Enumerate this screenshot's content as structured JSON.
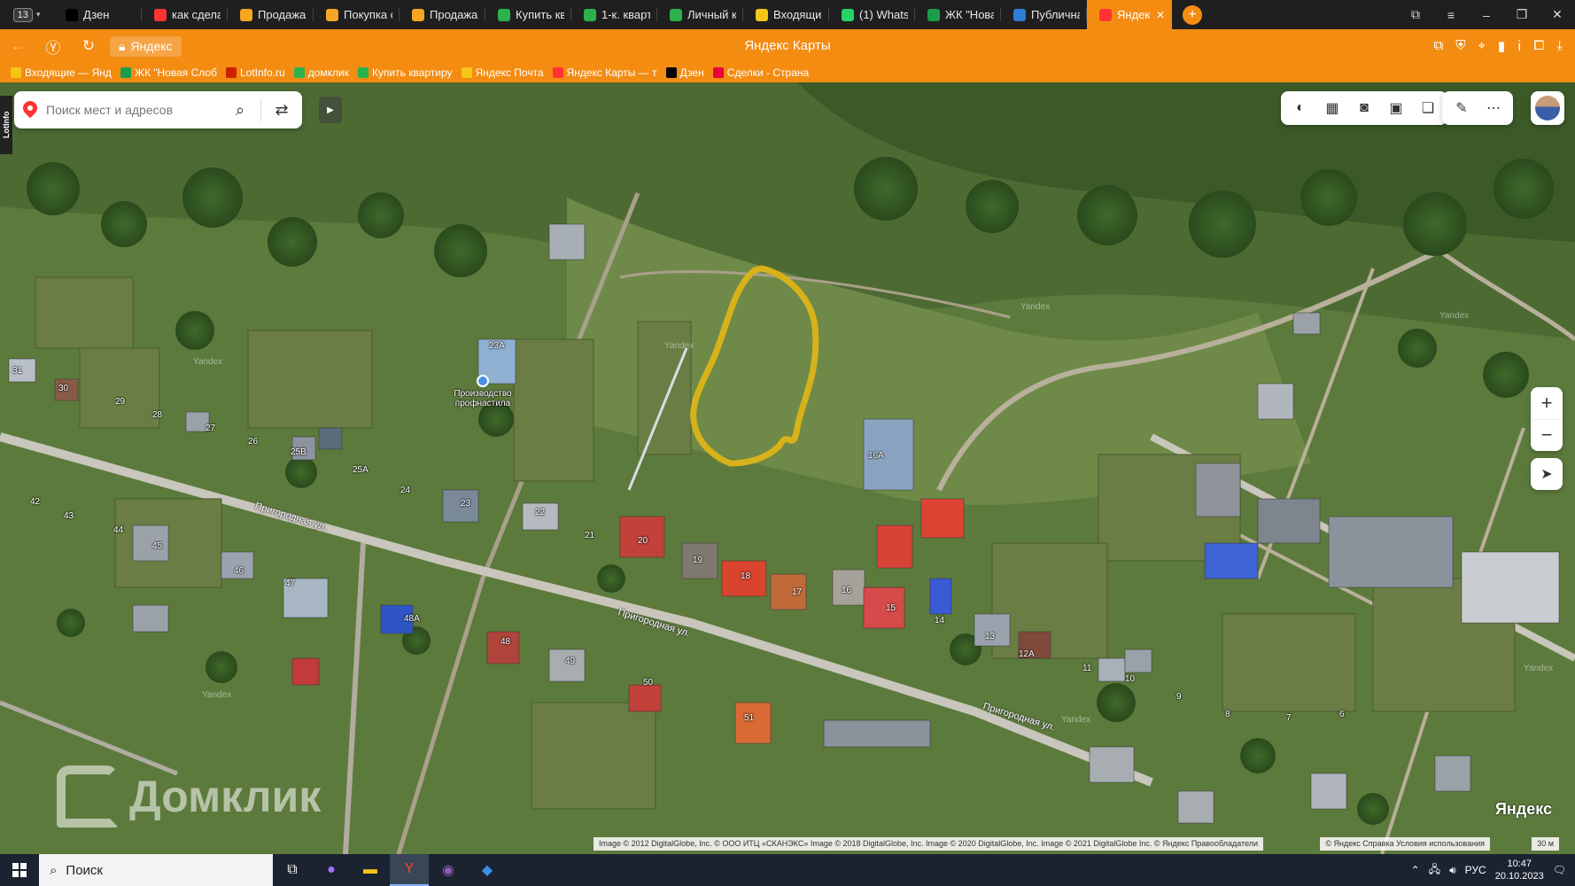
{
  "browser": {
    "tab_count": "13",
    "tabs": [
      {
        "label": "Дзен",
        "color": "#000000"
      },
      {
        "label": "как сделать",
        "color": "#ff3333"
      },
      {
        "label": "Продажа об",
        "color": "#f5a623"
      },
      {
        "label": "Покупка об",
        "color": "#f5a623"
      },
      {
        "label": "Продажа об",
        "color": "#f5a623"
      },
      {
        "label": "Купить квар",
        "color": "#2bb24c"
      },
      {
        "label": "1-к. квартир",
        "color": "#2bb24c"
      },
      {
        "label": "Личный каб",
        "color": "#2bb24c"
      },
      {
        "label": "Входящие –",
        "color": "#f5c518"
      },
      {
        "label": "(1) WhatsAp",
        "color": "#25d366"
      },
      {
        "label": "ЖК \"Новая С",
        "color": "#1a9e4b"
      },
      {
        "label": "Публичная к",
        "color": "#2e7dd7"
      },
      {
        "label": "Яндекс К",
        "color": "#ff3333"
      }
    ],
    "url": "Яндекс",
    "page_title": "Яндекс Карты",
    "bookmarks": [
      {
        "label": "Входящие — Янд",
        "color": "#f5c518"
      },
      {
        "label": "ЖК \"Новая Слоб",
        "color": "#1a9e4b"
      },
      {
        "label": "LotInfo.ru",
        "color": "#cc2200"
      },
      {
        "label": "домклик",
        "color": "#2bb24c"
      },
      {
        "label": "Купить квартиру",
        "color": "#2bb24c"
      },
      {
        "label": "Яндекс Почта",
        "color": "#f5c518"
      },
      {
        "label": "Яндекс Карты — т",
        "color": "#ff3333"
      },
      {
        "label": "Дзен",
        "color": "#000000"
      },
      {
        "label": "Сделки - Страна",
        "color": "#e8003d"
      }
    ]
  },
  "map": {
    "search_placeholder": "Поиск мест и адресов",
    "side_strip": "LotInfo",
    "poi": "Производство профнастила",
    "house_numbers": [
      "31",
      "30",
      "29",
      "28",
      "27",
      "26",
      "25В",
      "25А",
      "24",
      "23",
      "23А",
      "22",
      "21",
      "20",
      "19",
      "18",
      "17",
      "16",
      "16А",
      "15",
      "14",
      "13",
      "12А",
      "11",
      "10",
      "9",
      "8",
      "7",
      "6",
      "42",
      "43",
      "44",
      "45",
      "46",
      "47",
      "48А",
      "48",
      "49",
      "50",
      "51"
    ],
    "streets": [
      "Пригородная ул.",
      "Пригородная ул.",
      "Пригородная ул."
    ],
    "watermark": "Yandex",
    "domclick": "Домклик",
    "logo_main": "Яндекс",
    "copyright": "Image © 2012 DigitalGlobe, Inc. © ООО ИТЦ «СКАНЭКС» Image © 2018 DigitalGlobe, Inc. Image © 2020 DigitalGlobe, Inc. Image © 2021 DigitalGlobe Inc. © Яндекс  Правообладатели",
    "copyright2": "© Яндекс  Справка  Условия использования",
    "scale": "30 м",
    "highlight_color": "#d8b21a",
    "accent": "#f48c12"
  },
  "taskbar": {
    "search_label": "Поиск",
    "lang": "РУС",
    "time": "10:47",
    "date": "20.10.2023",
    "notif_count": "1"
  }
}
